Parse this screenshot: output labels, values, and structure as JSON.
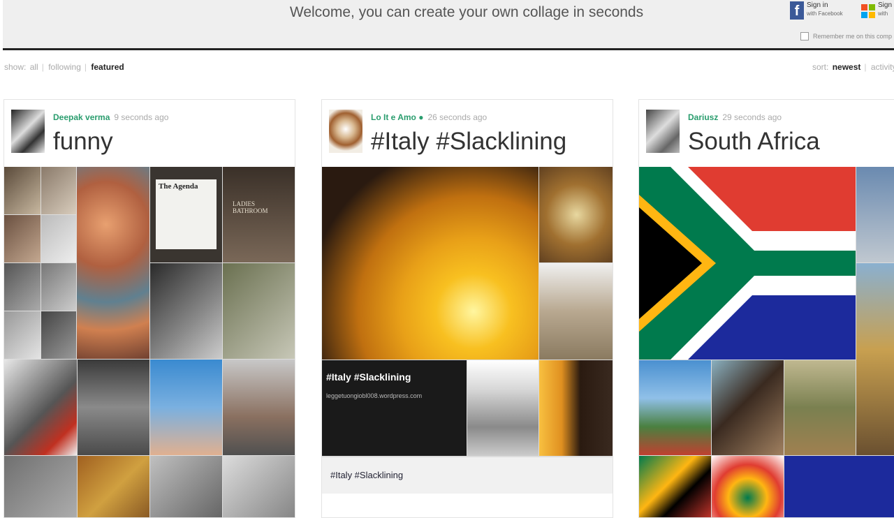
{
  "header": {
    "welcome": "Welcome, you can create your own collage in seconds",
    "facebook": {
      "line1": "Sign in",
      "line2": "with Facebook"
    },
    "microsoft": {
      "line1": "Sign",
      "line2": "with"
    },
    "remember": "Remember me on this comp"
  },
  "filters": {
    "show_label": "show:",
    "items": [
      "all",
      "following",
      "featured"
    ],
    "active": "featured"
  },
  "sort": {
    "label": "sort:",
    "items": [
      "newest",
      "activity"
    ],
    "active": "newest"
  },
  "cards": [
    {
      "author": "Deepak verma",
      "time": "9 seconds ago",
      "title": "funny"
    },
    {
      "author": "Lo It e Amo",
      "verified": true,
      "time": "26 seconds ago",
      "title": "#Italy #Slacklining",
      "caption_title": "#Italy #Slacklining",
      "caption_sub": "leggetuongiobl008.wordpress.com",
      "tags": "#Italy #Slacklining"
    },
    {
      "author": "Dariusz",
      "time": "29 seconds ago",
      "title": "South Africa"
    }
  ],
  "colors": {
    "author": "#2a9d6e",
    "topbar": "#efefef",
    "facebook": "#3b5998"
  },
  "tiles_text": {
    "agenda": "The Agenda",
    "ladies": "LADIES BATHROOM"
  }
}
